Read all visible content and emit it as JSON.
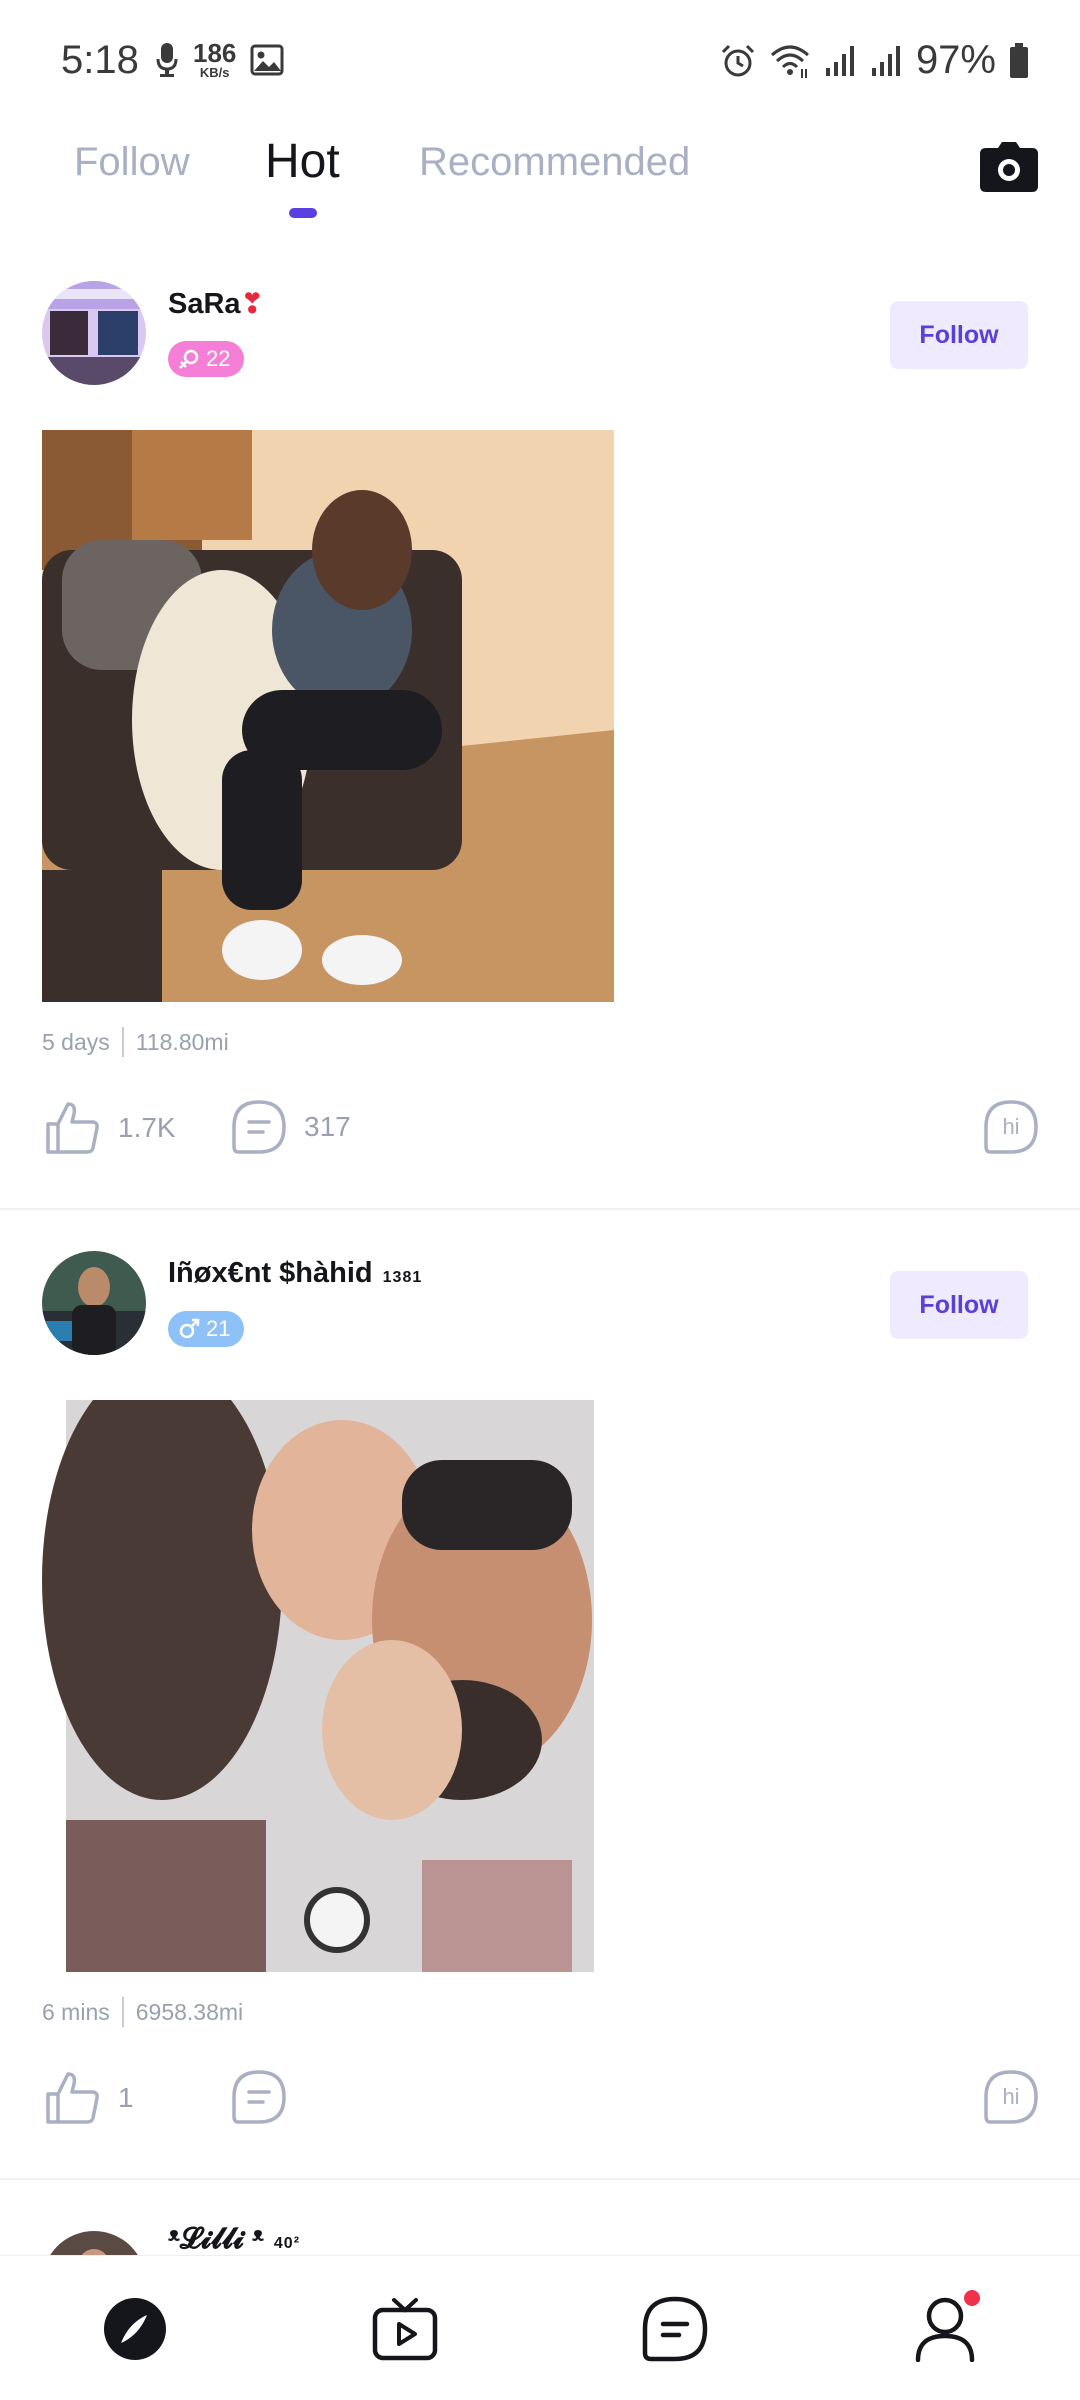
{
  "status_bar": {
    "time": "5:18",
    "speed_value": "186",
    "speed_unit": "KB/s",
    "battery": "97%"
  },
  "tabs": [
    {
      "label": "Follow",
      "active": false
    },
    {
      "label": "Hot",
      "active": true
    },
    {
      "label": "Recommended",
      "active": false
    }
  ],
  "colors": {
    "accent": "#5b3fe0",
    "follow_btn_bg": "#efeafd",
    "female_badge": "#f57fd6",
    "male_badge": "#8ec1f7",
    "notification": "#f0314b"
  },
  "posts": [
    {
      "username": "SaRa",
      "username_emoji": "❣",
      "gender_icon": "female-icon",
      "age": "22",
      "follow_label": "Follow",
      "time_ago": "5 days",
      "distance": "118.80mi",
      "likes": "1.7K",
      "comments": "317",
      "hi_label": "hi"
    },
    {
      "username": "Iñøx€nt $hàhid",
      "username_suffix": "1381",
      "gender_icon": "male-icon",
      "age": "21",
      "follow_label": "Follow",
      "time_ago": "6 mins",
      "distance": "6958.38mi",
      "likes": "1",
      "comments": "",
      "hi_label": "hi"
    },
    {
      "username": "ᵜ𝓛𝓲𝓵𝓵𝓲 ᵜ",
      "username_suffix": "40²"
    }
  ],
  "bottom_nav": [
    {
      "icon": "compass-icon",
      "active": true
    },
    {
      "icon": "live-tv-icon",
      "active": false
    },
    {
      "icon": "chat-bubble-icon",
      "active": false
    },
    {
      "icon": "profile-icon",
      "active": false,
      "has_notification": true
    }
  ]
}
